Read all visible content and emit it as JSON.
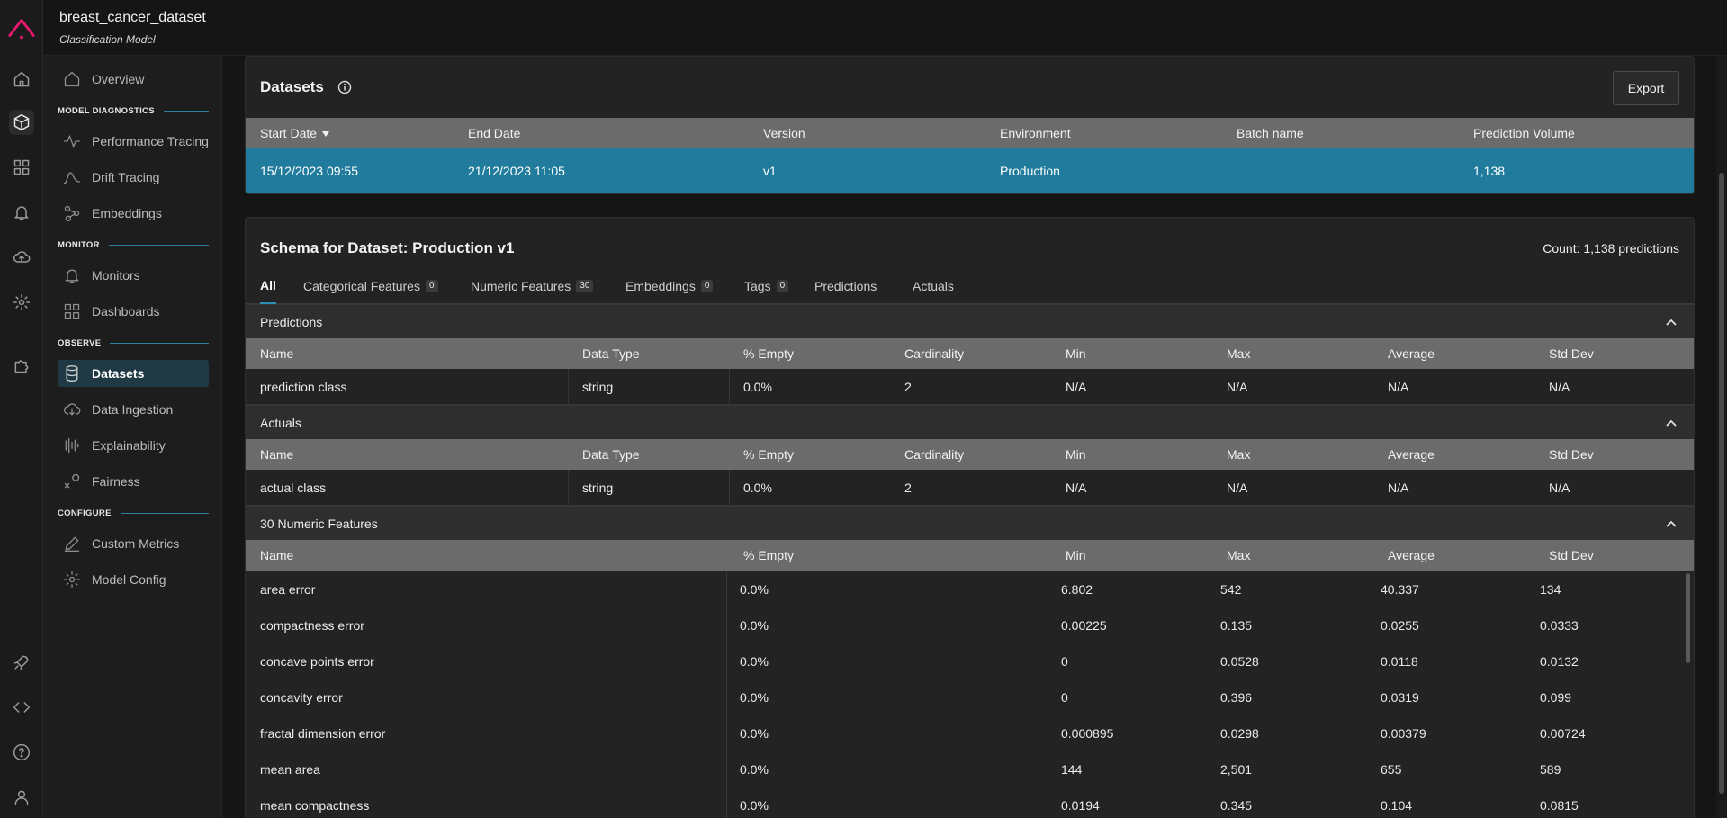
{
  "app": {
    "title": "breast_cancer_dataset",
    "subtitle": "Classification Model"
  },
  "rail": [
    "logo-icon",
    "home-icon",
    "cube-icon",
    "grid-icon",
    "bell-icon",
    "cloud-upload-icon",
    "gear-icon",
    "puzzle-icon",
    "rocket-icon",
    "code-icon",
    "help-icon",
    "user-icon"
  ],
  "sidebar": {
    "overview": "Overview",
    "sections": {
      "model_diagnostics": "MODEL DIAGNOSTICS",
      "monitor": "MONITOR",
      "observe": "OBSERVE",
      "configure": "CONFIGURE"
    },
    "items": {
      "performance_tracing": "Performance Tracing",
      "drift_tracing": "Drift Tracing",
      "embeddings": "Embeddings",
      "monitors": "Monitors",
      "dashboards": "Dashboards",
      "datasets": "Datasets",
      "data_ingestion": "Data Ingestion",
      "explainability": "Explainability",
      "fairness": "Fairness",
      "custom_metrics": "Custom Metrics",
      "model_config": "Model Config"
    }
  },
  "datasets": {
    "title": "Datasets",
    "export": "Export",
    "columns": [
      "Start Date",
      "End Date",
      "Version",
      "Environment",
      "Batch name",
      "Prediction Volume"
    ],
    "row": {
      "start": "15/12/2023 09:55",
      "end": "21/12/2023 11:05",
      "version": "v1",
      "environment": "Production",
      "batch": "",
      "volume": "1,138"
    }
  },
  "schema": {
    "title": "Schema for Dataset: Production v1",
    "count": "Count: 1,138 predictions",
    "tabs": [
      {
        "label": "All",
        "badge": null
      },
      {
        "label": "Categorical Features",
        "badge": "0"
      },
      {
        "label": "Numeric Features",
        "badge": "30"
      },
      {
        "label": "Embeddings",
        "badge": "0"
      },
      {
        "label": "Tags",
        "badge": "0"
      },
      {
        "label": "Predictions",
        "badge": null
      },
      {
        "label": "Actuals",
        "badge": null
      }
    ],
    "predictions_header": "Predictions",
    "actuals_header": "Actuals",
    "numeric_header": "30 Numeric Features",
    "table_columns": [
      "Name",
      "Data Type",
      "% Empty",
      "Cardinality",
      "Min",
      "Max",
      "Average",
      "Std Dev"
    ],
    "numeric_columns": [
      "Name",
      "% Empty",
      "Min",
      "Max",
      "Average",
      "Std Dev"
    ],
    "prediction_row": [
      "prediction class",
      "string",
      "0.0%",
      "2",
      "N/A",
      "N/A",
      "N/A",
      "N/A"
    ],
    "actual_row": [
      "actual class",
      "string",
      "0.0%",
      "2",
      "N/A",
      "N/A",
      "N/A",
      "N/A"
    ],
    "numeric_rows": [
      [
        "area error",
        "0.0%",
        "6.802",
        "542",
        "40.337",
        "134"
      ],
      [
        "compactness error",
        "0.0%",
        "0.00225",
        "0.135",
        "0.0255",
        "0.0333"
      ],
      [
        "concave points error",
        "0.0%",
        "0",
        "0.0528",
        "0.0118",
        "0.0132"
      ],
      [
        "concavity error",
        "0.0%",
        "0",
        "0.396",
        "0.0319",
        "0.099"
      ],
      [
        "fractal dimension error",
        "0.0%",
        "0.000895",
        "0.0298",
        "0.00379",
        "0.00724"
      ],
      [
        "mean area",
        "0.0%",
        "144",
        "2,501",
        "655",
        "589"
      ],
      [
        "mean compactness",
        "0.0%",
        "0.0194",
        "0.345",
        "0.104",
        "0.0815"
      ]
    ]
  },
  "colors": {
    "accent": "#2b8db3",
    "selected_row": "#217b9c",
    "logo": "#e6196e"
  }
}
